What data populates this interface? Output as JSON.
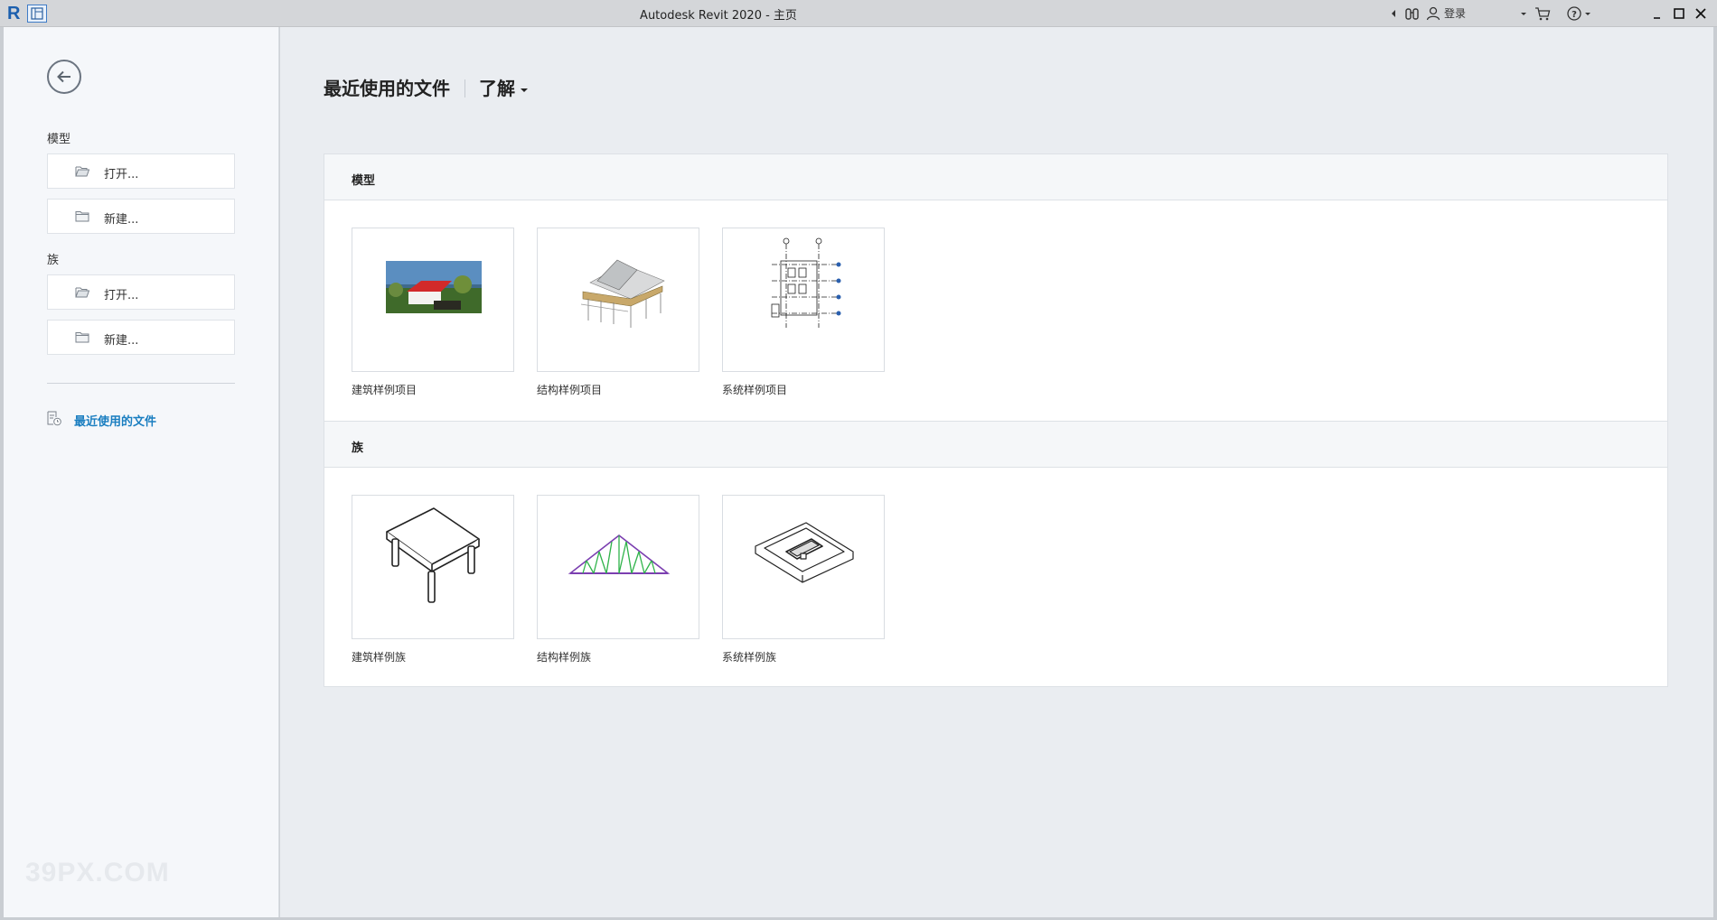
{
  "titlebar": {
    "title": "Autodesk Revit 2020 - 主页",
    "login_label": "登录"
  },
  "sidebar": {
    "model_heading": "模型",
    "model_open": "打开...",
    "model_new": "新建...",
    "family_heading": "族",
    "family_open": "打开...",
    "family_new": "新建...",
    "recent_files": "最近使用的文件"
  },
  "watermark": "39PX.COM",
  "nav": {
    "recent": "最近使用的文件",
    "learn": "了解"
  },
  "sections": {
    "models": {
      "heading": "模型",
      "items": [
        "建筑样例项目",
        "结构样例项目",
        "系统样例项目"
      ]
    },
    "families": {
      "heading": "族",
      "items": [
        "建筑样例族",
        "结构样例族",
        "系统样例族"
      ]
    }
  },
  "colors": {
    "accent_link": "#1a7ec0",
    "main_bg": "#eaedf1",
    "sidebar_bg": "#f5f7fa"
  },
  "icons": [
    "revit-logo-icon",
    "quick-access-icon",
    "search-binoculars-icon",
    "user-icon",
    "cart-icon",
    "help-icon",
    "back-arrow-icon",
    "folder-open-icon",
    "new-file-icon",
    "recent-files-icon"
  ]
}
